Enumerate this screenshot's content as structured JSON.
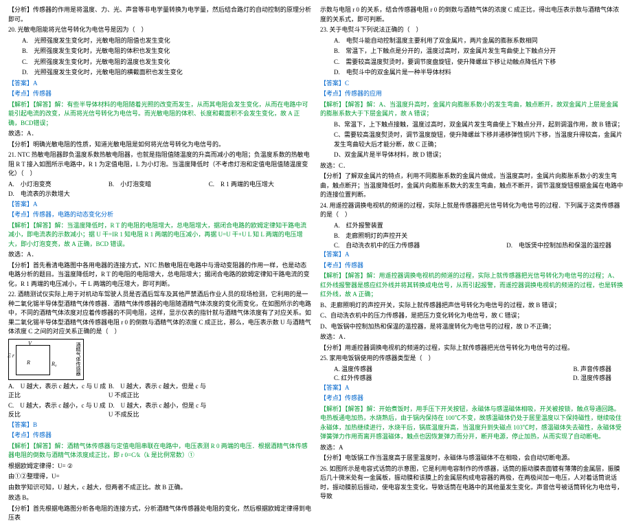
{
  "left": {
    "analysis1": "【分析】传感器的作用是将温度、力、光、声音等非电学量转换为电学量，然后结合路灯的自动控制的原理分析即可。",
    "q20_stem": "20. 光敏电阻能将光信号转化为电信号是因为（　）",
    "q20_a": "A.　光照强度发生变化时，光敏电阻的阻值也发生变化",
    "q20_b": "B.　光照强度发生变化时，光敏电阻的体积也发生变化",
    "q20_c": "C.　光照强度发生变化时，光敏电阻的温度也发生变化",
    "q20_d": "D.　光照强度发生变化时，光敏电阻的横截面积也发生变化",
    "ans_a": "【答案】A",
    "kp_sensor": "【考点】传感器",
    "expl20": "【解析】【解答】解：有些半导体材料的电阻随着光照的改变而发生，从而其电阻会发生变化，从而在电路中可能引起电流的改变，从而将光信号转化为电信号。而光敏电阻的体积、长度和截面积不会发生变化，故 A 正确，BCD错误；",
    "pick_a": "故选：A．",
    "g20": "【分析】明确光敏电阻的性质，知道光敏电阻是如何将光信号转化为电信号的。",
    "q21_stem": "21. NTC 热敏电阻器即负温度系数热敏电阻器，也就是指阻值随温度的升高而减小的电阻；负温度系数的热敏电阻 R T 接入如图所示电路中，R 1 为定值电阻，L 为小灯泡。当温度降低时（不考虑灯泡和定值电阻值随温度变化）（　）",
    "q21_a": "A.　小灯泡变亮",
    "q21_b": "B.　小灯泡变暗",
    "q21_c": "C.　R 1 两端的电压增大",
    "q21_d": "D.　电流表的示数增大",
    "kp_dyn": "【考点】传感器，电路的动态变化分析",
    "expl21": "【解析】【解答】解：当温度降低时，R T 的电阻的电阻增大，总电阻增大，据闭合电路的欧姆定律知干路电流减小，即电流表的示数减小；据 U 干=IR 1 知电阻 R 1 两端的电压减小，再据 U=U 干+U L 知 L 两端的电压增大，即小灯泡变亮，故 A 正确，BCD 错误。",
    "g21": "【分析】首先看清电路图中各用电器的连接方式，NTC 热敏电阻在电路中与滑动变阻器的作用一样，也是动态电路分析的题目。当温度降低时，R T 的电阻的电阻增大，总电阻增大；据闭合电路的欧姆定律知干路电流的变化，R 1 两端的电压减小，干 L 两端的电压增大，即可判断。",
    "q22_stem": "22. 酒精测试仪实际上用于对机动车驾驶人员是否酒后驾车及其他严禁酒后作业人员的现场检测，它利用的是一种二氧化锡半导体型酒精气体传感器．酒精气体传感器的电阻随酒精气体浓度的变化而变化，在如图所示的电路中，不同的酒精气体浓度对应着传感器的不同电阻，这样，显示仪表的指针就与酒精气体浓度有了对应关系。如果二氧化锡半导体型酒精气体传感器电阻 r 0 的倒数与酒精气体的浓度 C 成正比，那么，电压表示数 U 与酒精气体浓度 C 之间的对应关系正确的是（　）",
    "dV": "V",
    "dE": "E  r",
    "dR": "R",
    "dR0": "R₀",
    "dNote": "酒精气体传感器",
    "q22_a": "A.　U 越大，表示 c 越大，c 与 U 成正比",
    "q22_b": "B.　U 越大，表示 c 越大，但是 c 与 U 不成正比",
    "q22_c": "C.　U 越大，表示 c 越小，c 与 U 成反比",
    "q22_d": "D.　U 越大，表示 c 越小，但是 c 与 U 不成反比",
    "ans_b": "【答案】B",
    "expl22": "【解析】【解答】解：酒精气体传感器与定值电阻串联在电路中，电压表测 R 0 两端的电压．根据酒精气体传感器电阻的倒数与酒精气体浓度成正比，即 r 0=C/k（k 是比例常数）①",
    "ohm": "根据欧姆定律得：U=  ②",
    "sub": "由①②整理得，U=",
    "math": "由数学知识可知，U 越大，c 越大，但两者不成正比。故 B 正确。",
    "pick_b": "故选 B。",
    "g22": "【分析】首先根据电路图分析各电阻的连接方式，分析酒精气体传感器处电阻的变化，然后根据欧姆定律得到电压表"
  },
  "right": {
    "cont22": "示数与电阻 r 0 的关系，结合传感器电阻 r 0 的倒数与酒精气体的浓度 C 成正比，得出电压表示数与酒精气体浓度的关系式，即可判断。",
    "q23_stem": "23. 关于电熨斗下列说法正确的（　）",
    "q23_a": "A.　电熨斗能自动控制温度主要利用了双金属片，两片金属的膨胀系数相同",
    "q23_b": "B.　常温下，上下触点是分开的，温度过高时，双金属片发生弯曲使上下触点分开",
    "q23_c": "C.　需要较高温度熨烫时，要调节度盘旋钮，使升降螺丝下移让动触点降低片下移",
    "q23_d": "D.　电熨斗中的双金属片是一种半导体材料",
    "ans_c1": "【答案】C",
    "kp_app": "【考点】传感器的应用",
    "expl23": "【解析】【解答】解：A、当温度升高时，金属片向膨胀系数小的发生弯曲，触点断开，故双金属片上层是金属的膨胀系数大于下层金属片，故 A 错误；",
    "b23": "B、常温下，上下触点接触，温度过高时，双金属片发生弯曲使上下触点分开，起到调温作用，故 B 错误；",
    "c23": "C、需要较高温度熨烫时，调节温度旋钮，使升降螺丝下移并通移弹性铜片下移，当温度升得较高，金属片发生弯曲较大后才能分断，故 C 正确；",
    "d23": "D、双金属片是半导体材料，故 D 错误；",
    "pick_c": "故选：C．",
    "g23": "【分析】了解双金属片的特点，利用不同膨胀系数的金属片做成，当温度高时，金属片向膨胀系数小的发生弯曲，触点断开；当温度降低时，金属片向膨胀系数大的发生弯曲，触点不断开，调节温度旋钮根据金属在电路中的连接位置判断。",
    "q24_stem": "24. 用遥控器调换电视机的频道的过程，实际上就是传感器把光信号转化为电信号的过程．下列属于这类传感器的是（　）",
    "q24_a": "A.　红外报警装置",
    "q24_b": "B.　走廊照明灯的声控开关",
    "q24_c": "C.　自动洗衣机中的压力传感器",
    "q24_d": "D.　电饭煲中控制加热和保温的温控器",
    "expl24": "【解析】【解答】解：用遥控器调换电视机的频道的过程，实际上就传感器把光信号转化为电信号的过程；A、红外线报警器是感应红外线并将其转换成电信号，从而引起报警，而遥控器调换电视机的频道的过程，也是转换红外线，故 A 正确；",
    "b24": "B、走廊照明灯的声控开关，实际上就传感器把声信号转化为电信号的过程，故 B 错误；",
    "c24": "C、自动洗衣机中的压力传感器，是把压力变化转化为电信号，故 C 错误；",
    "d24": "D、电饭锅中控制加热和保温的温控器，是将温度转化为电信号的过程，故 D 不正确；",
    "expl24b": "【分析】用遥控器调换电视机的频道的过程，实际上就传感器把光信号转化为电信号的过程。",
    "q25_stem": "25. 家用电饭锅使用的传感器类型是（　）",
    "q25_a": "A.  温度传感器",
    "q25_b": "B.  声音传感器",
    "q25_c": "C.  红外传感器",
    "q25_d": "D.  湿度传感器",
    "expl25": "【解析】【解答】解：开始煮饭时，用手压下开关按钮，永磁体与感温磁体相吸，开关被按锁，触点导通回路。电热板通电加热，水烧熟后，由于锅内保持在 100℃不变，故感温磁体仍处于居里温度以下保持磁性，继续吸住永磁体，加热继续进行，水烧干后，锅底温度升高，当温度升到失磁点 103℃时，感温磁体失去磁性，永磁体受弹簧弹力作用而离开感温磁体，触点也因恢复弹力而分开，断开电源，停止加热，从而实现了自动断电。",
    "pick_a2": "故选：A",
    "g25": "【分析】电饭锅工作当温度高于居里温度时，永磁体与感温磁体不在相吸，会自动切断电源。",
    "q26_stem": "26. 如图所示是电容式话筒的示意图，它是利用电容制作的传感器，话筒的振动膜表面镀有薄薄的金属层，振膜后几十微米处有一金属板，振动膜和该膜上的金属层构成电容器的两极，在两极间加一电压，人对着话筒说话时，振动膜前后振动，使电容发生变化，导致话筒在电路中的其他量发生变化，声音信号被话筒转化为电信号，导致"
  }
}
